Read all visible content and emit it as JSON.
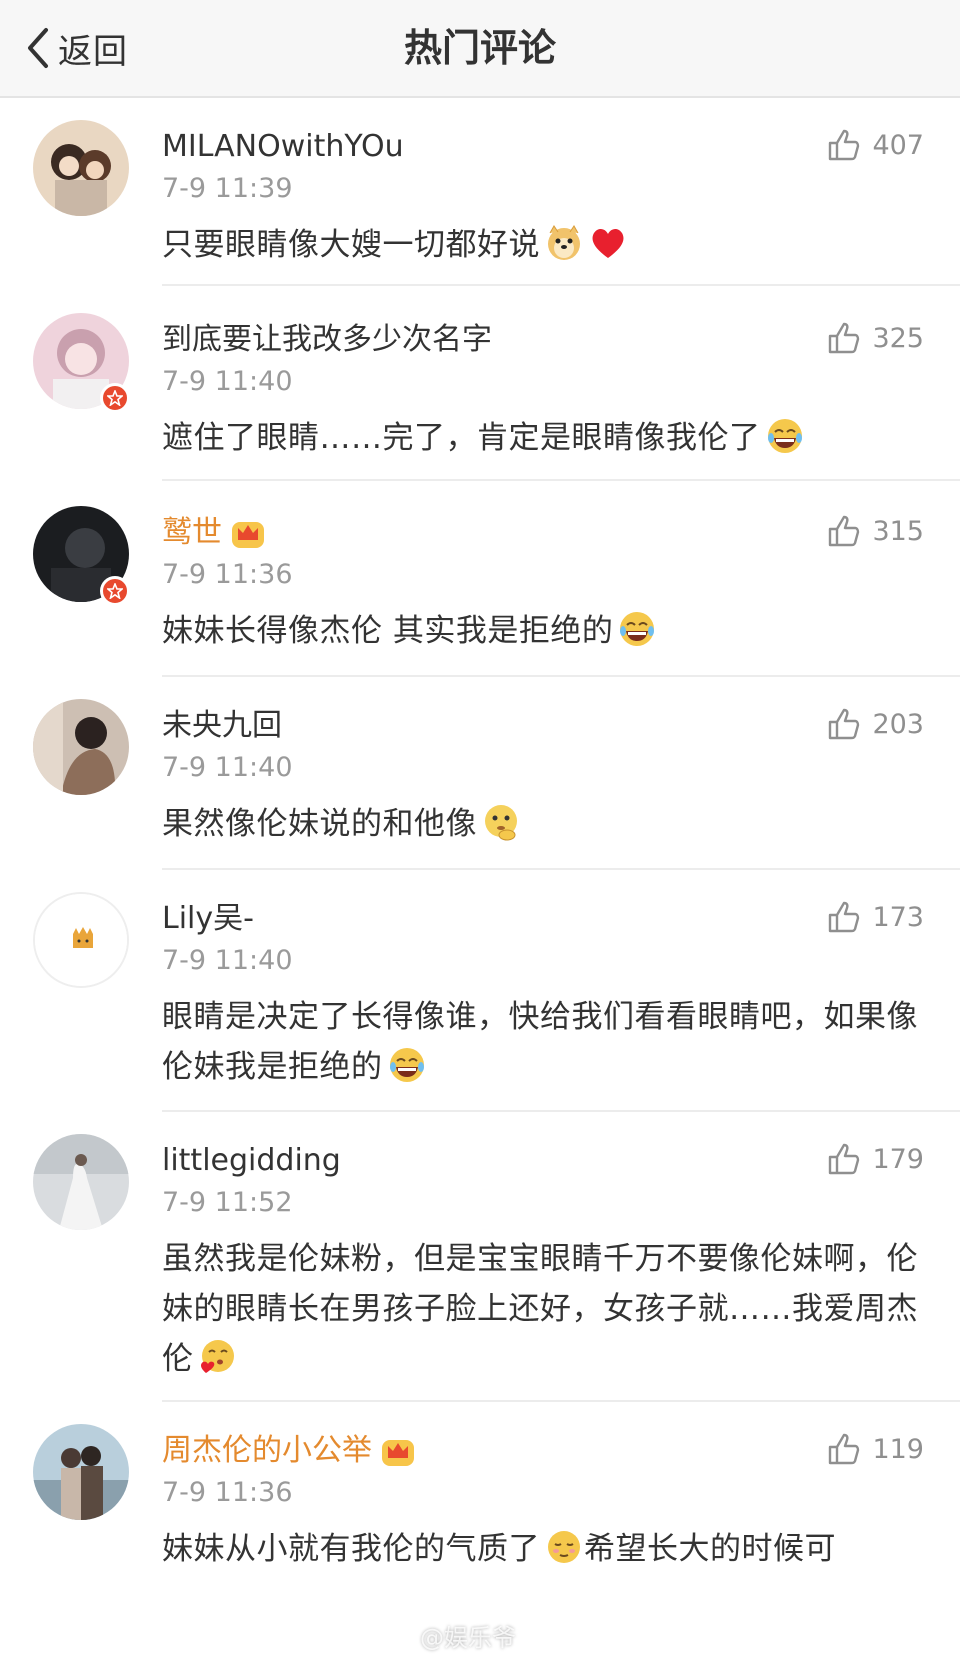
{
  "nav": {
    "back_label": "返回",
    "title": "热门评论"
  },
  "comments": [
    {
      "user": "MILANOwithYOu",
      "time": "7-9 11:39",
      "likes": "407",
      "text": "只要眼睛像大嫂一切都好说"
    },
    {
      "user": "到底要让我改多少次名字",
      "time": "7-9 11:40",
      "likes": "325",
      "text": "遮住了眼睛……完了，肯定是眼睛像我伦了"
    },
    {
      "user": "鹫世",
      "time": "7-9 11:36",
      "likes": "315",
      "text": "妹妹长得像杰伦 其实我是拒绝的"
    },
    {
      "user": "未央九回",
      "time": "7-9 11:40",
      "likes": "203",
      "text": "果然像伦妹说的和他像"
    },
    {
      "user": "Lily吴-",
      "time": "7-9 11:40",
      "likes": "173",
      "text": "眼睛是决定了长得像谁，快给我们看看眼睛吧，如果像伦妹我是拒绝的"
    },
    {
      "user": "littlegidding",
      "time": "7-9 11:52",
      "likes": "179",
      "text": "虽然我是伦妹粉，但是宝宝眼睛千万不要像伦妹啊，伦妹的眼睛长在男孩子脸上还好，女孩子就……我爱周杰伦"
    },
    {
      "user": "周杰伦的小公举",
      "time": "7-9 11:36",
      "likes": "119",
      "text": "妹妹从小就有我伦的气质了"
    },
    {
      "text_tail": "希望长大的时候可"
    }
  ],
  "watermark": "@娱乐爷",
  "colors": {
    "vip_name": "#e48a2e",
    "badge": "#e8492e",
    "meta": "#9a9a9a"
  }
}
